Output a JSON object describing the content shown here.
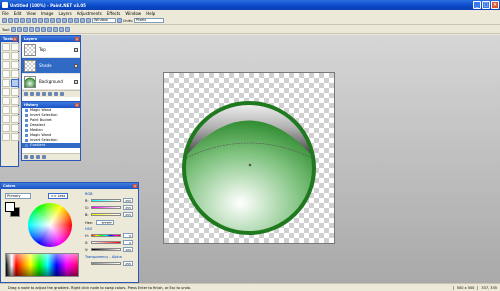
{
  "window": {
    "title": "Untitled (100%) - Paint.NET v3.05",
    "buttons": [
      "_",
      "□",
      "×"
    ]
  },
  "menu": [
    "File",
    "Edit",
    "View",
    "Image",
    "Layers",
    "Adjustments",
    "Effects",
    "Window",
    "Help"
  ],
  "toolbar": {
    "window_label": "Window",
    "units_label": "Units:",
    "units_value": "Pixels"
  },
  "toolbar2": {
    "tool_label": "Tool:"
  },
  "tools_panel": {
    "title": "Tools",
    "count": 22,
    "selected_index": 9
  },
  "layers_panel": {
    "title": "Layers",
    "layers": [
      {
        "name": "Top",
        "checked": "✓",
        "selected": false
      },
      {
        "name": "Shade",
        "checked": "✓",
        "selected": true
      },
      {
        "name": "Background",
        "checked": "✓",
        "selected": false
      }
    ]
  },
  "history_panel": {
    "title": "History",
    "items": [
      "Magic Wand",
      "Invert Selection",
      "Paint Bucket",
      "Deselect",
      "Median",
      "Magic Wand",
      "Invert Selection",
      "Gradient"
    ],
    "selected_index": 7
  },
  "colors_panel": {
    "title": "Colors",
    "mode_select": "Primary",
    "less_button": "<< Less",
    "rgb_label": "RGB",
    "hsv_label": "HSV",
    "hex_label": "Hex:",
    "hex_value": "FFFFFF",
    "rgb": [
      {
        "label": "R:",
        "value": "255"
      },
      {
        "label": "G:",
        "value": "255"
      },
      {
        "label": "B:",
        "value": "255"
      }
    ],
    "hsv": [
      {
        "label": "H:",
        "value": "0"
      },
      {
        "label": "S:",
        "value": "0"
      },
      {
        "label": "V:",
        "value": "100"
      }
    ],
    "transparency_label": "Transparency - Alpha",
    "alpha_value": "255"
  },
  "status": {
    "hint": "Drag a node to adjust the gradient. Right click node to swap colors. Press Enter to finish, or Esc to undo.",
    "size": "500 x 500",
    "coords": "337, 335"
  },
  "colors": {
    "title_bar": "#0a48c8",
    "accent": "#316ac5",
    "dome_green": "#2e8b2e"
  }
}
